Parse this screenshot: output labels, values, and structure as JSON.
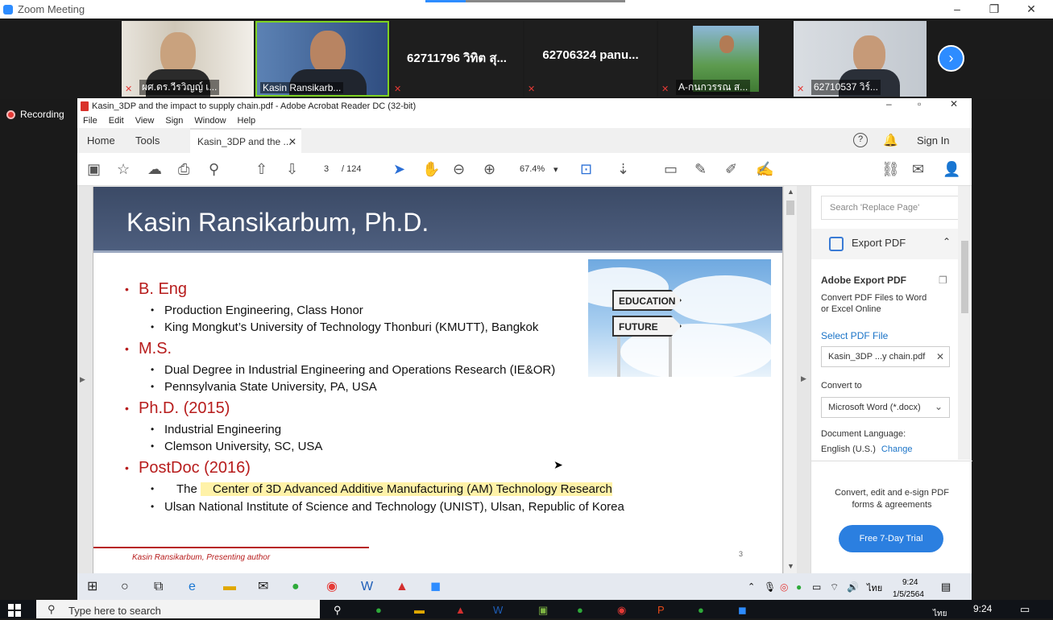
{
  "zoom": {
    "title": "Zoom Meeting",
    "minimize": "–",
    "restore": "❐",
    "close": "✕",
    "recording": "Recording",
    "next_icon": "›",
    "participants": [
      {
        "name": "ผศ.ดร.วีรวิญญ์ เ...",
        "video": true
      },
      {
        "name": "Kasin Ransikarb...",
        "video": true,
        "active": true
      },
      {
        "name": "62711796 วิทิต สุ...",
        "video": false
      },
      {
        "name": "62706324 panu...",
        "video": false
      },
      {
        "name": "A-กนกวรรณ ส...",
        "video": true
      },
      {
        "name": "62710537 วิร์...",
        "video": true
      }
    ]
  },
  "acrobat": {
    "title": "Kasin_3DP and the impact to supply chain.pdf - Adobe Acrobat Reader DC (32-bit)",
    "menu": [
      "File",
      "Edit",
      "View",
      "Sign",
      "Window",
      "Help"
    ],
    "tabs": {
      "home": "Home",
      "tools": "Tools",
      "doc": "Kasin_3DP and the ...",
      "close": "✕"
    },
    "sign_in": "Sign In",
    "page_current": "3",
    "page_total": "/ 124",
    "zoom": "67.4%",
    "right_panel": {
      "search_placeholder": "Search 'Replace Page'",
      "export_pdf": "Export PDF",
      "adobe_export": "Adobe Export PDF",
      "convert_desc_1": "Convert PDF Files to Word",
      "convert_desc_2": "or Excel Online",
      "select_file": "Select PDF File",
      "file_name": "Kasin_3DP ...y chain.pdf",
      "convert_to": "Convert to",
      "format": "Microsoft Word (*.docx)",
      "doc_lang": "Document Language:",
      "lang": "English (U.S.)",
      "change": "Change",
      "promo_1": "Convert, edit and e-sign PDF",
      "promo_2": "forms & agreements",
      "trial": "Free 7-Day Trial"
    }
  },
  "slide": {
    "title": "Kasin Ransikarbum, Ph.D.",
    "sign_education": "EDUCATION",
    "sign_future": "FUTURE",
    "sections": [
      {
        "heading": "B. Eng",
        "items": [
          "Production Engineering, Class Honor",
          "King Mongkut’s University of  Technology Thonburi (KMUTT), Bangkok"
        ]
      },
      {
        "heading": "M.S.",
        "items": [
          "Dual Degree in Industrial Engineering and Operations Research (IE&OR)",
          "Pennsylvania State University, PA, USA"
        ]
      },
      {
        "heading": "Ph.D. (2015)",
        "items": [
          "Industrial Engineering",
          "Clemson University, SC, USA"
        ]
      },
      {
        "heading": "PostDoc (2016)",
        "items": [
          "Ulsan National Institute of Science and Technology (UNIST), Ulsan, Republic of Korea"
        ]
      }
    ],
    "postdoc_prefix": "The ",
    "postdoc_highlight": "Center of 3D Advanced Additive Manufacturing (AM) Technology Research",
    "footer": "Kasin Ransikarbum, Presenting author",
    "page_number": "3"
  },
  "inner_taskbar": {
    "time": "9:24",
    "date": "1/5/2564",
    "lang": "ไทย"
  },
  "outer_taskbar": {
    "search": "Type here to search",
    "time": "9:24",
    "lang": "ไทย"
  }
}
